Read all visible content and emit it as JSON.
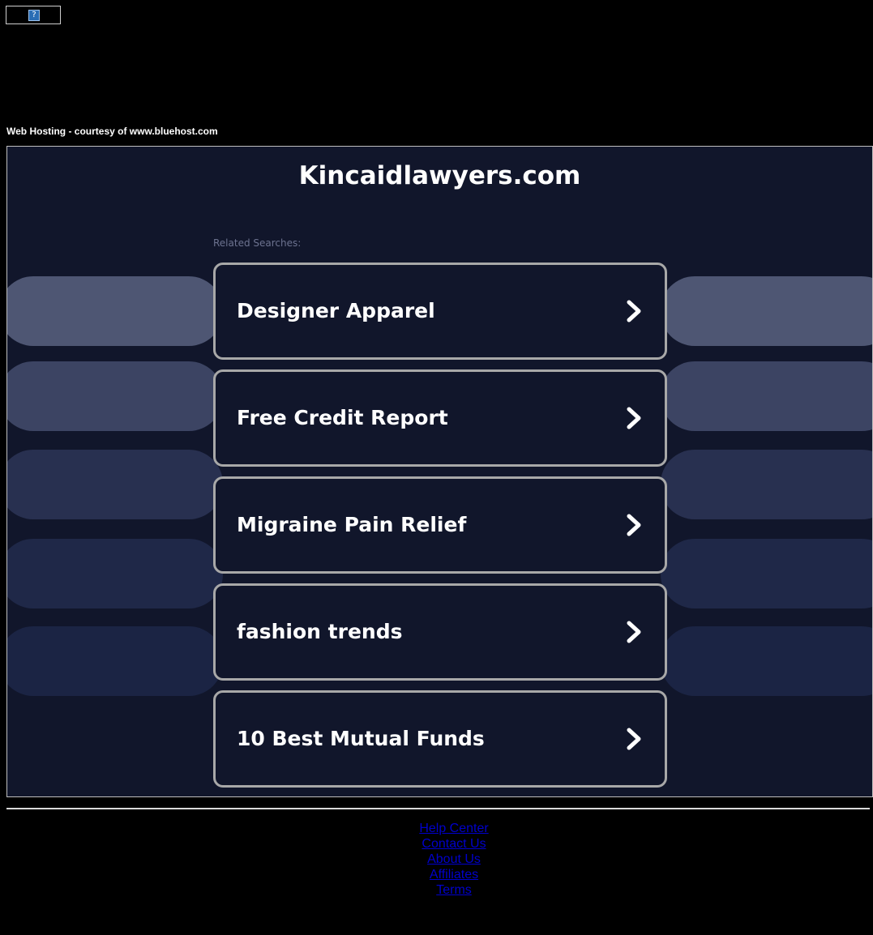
{
  "badge": {
    "glyph": "?"
  },
  "hosting_note": "Web Hosting - courtesy of www.bluehost.com",
  "site": {
    "title": "Kincaidlawyers.com",
    "related_label": "Related Searches:"
  },
  "colors": {
    "background": "#000000",
    "panel": "#11162b",
    "pill_1": "#4e5673",
    "pill_2": "#3c4463",
    "pill_3": "#283050",
    "pill_4": "#1f2848",
    "pill_5": "#1b2444",
    "box_border": "#a8a8a8",
    "link_blue": "#0000cc"
  },
  "searches": [
    {
      "label": "Designer Apparel",
      "icon": "chevron-right-icon"
    },
    {
      "label": "Free Credit Report",
      "icon": "chevron-right-icon"
    },
    {
      "label": "Migraine Pain Relief",
      "icon": "chevron-right-icon"
    },
    {
      "label": "fashion trends",
      "icon": "chevron-right-icon"
    },
    {
      "label": "10 Best Mutual Funds",
      "icon": "chevron-right-icon"
    }
  ],
  "footer": {
    "links": [
      "Help Center",
      "Contact Us",
      "About Us",
      "Affiliates",
      "Terms"
    ]
  }
}
